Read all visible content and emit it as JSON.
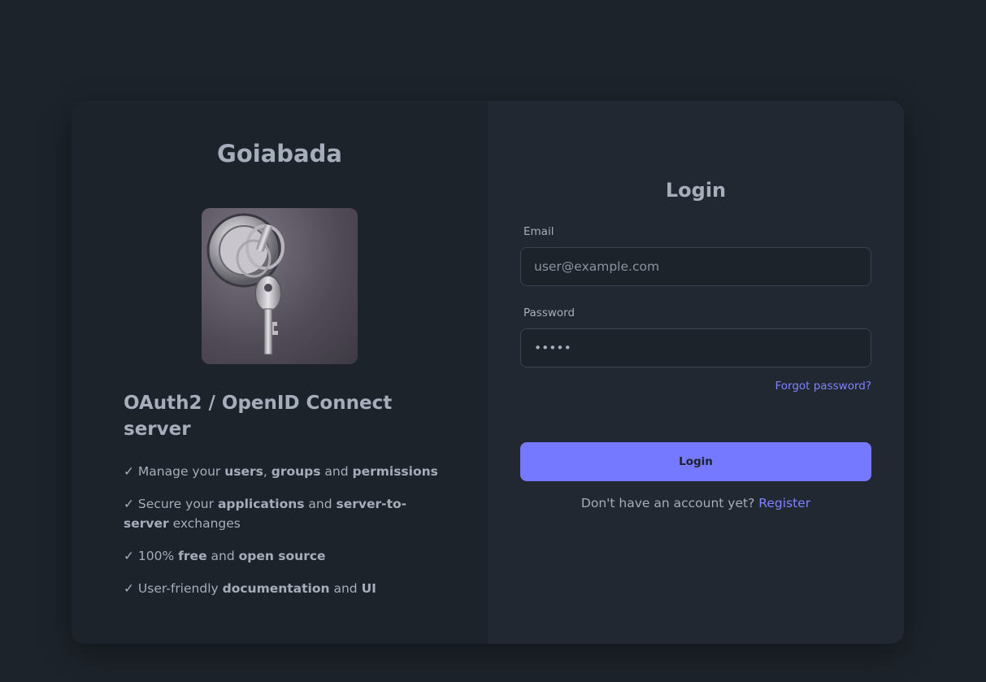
{
  "brand": {
    "name": "Goiabada"
  },
  "hero": {
    "subtitle": "OAuth2 / OpenID Connect server"
  },
  "features": [
    {
      "check": "✓",
      "parts": [
        {
          "text": " Manage your ",
          "bold": false
        },
        {
          "text": "users",
          "bold": true
        },
        {
          "text": ", ",
          "bold": false
        },
        {
          "text": "groups",
          "bold": true
        },
        {
          "text": " and ",
          "bold": false
        },
        {
          "text": "permissions",
          "bold": true
        }
      ]
    },
    {
      "check": "✓",
      "parts": [
        {
          "text": " Secure your ",
          "bold": false
        },
        {
          "text": "applications",
          "bold": true
        },
        {
          "text": " and ",
          "bold": false
        },
        {
          "text": "server-to-server",
          "bold": true
        },
        {
          "text": " exchanges",
          "bold": false
        }
      ]
    },
    {
      "check": "✓",
      "parts": [
        {
          "text": " 100% ",
          "bold": false
        },
        {
          "text": "free",
          "bold": true
        },
        {
          "text": " and ",
          "bold": false
        },
        {
          "text": "open source",
          "bold": true
        }
      ]
    },
    {
      "check": "✓",
      "parts": [
        {
          "text": " User-friendly ",
          "bold": false
        },
        {
          "text": "documentation",
          "bold": true
        },
        {
          "text": " and ",
          "bold": false
        },
        {
          "text": "UI",
          "bold": true
        }
      ]
    }
  ],
  "login": {
    "title": "Login",
    "email_label": "Email",
    "email_placeholder": "user@example.com",
    "password_label": "Password",
    "password_value": "•••••",
    "forgot_link": "Forgot password?",
    "submit_label": "Login",
    "register_prompt": "Don't have an account yet?",
    "register_link": "Register"
  },
  "colors": {
    "background": "#1d232a",
    "panel": "#222831",
    "accent": "#7479ff",
    "text": "#a6adbb"
  }
}
